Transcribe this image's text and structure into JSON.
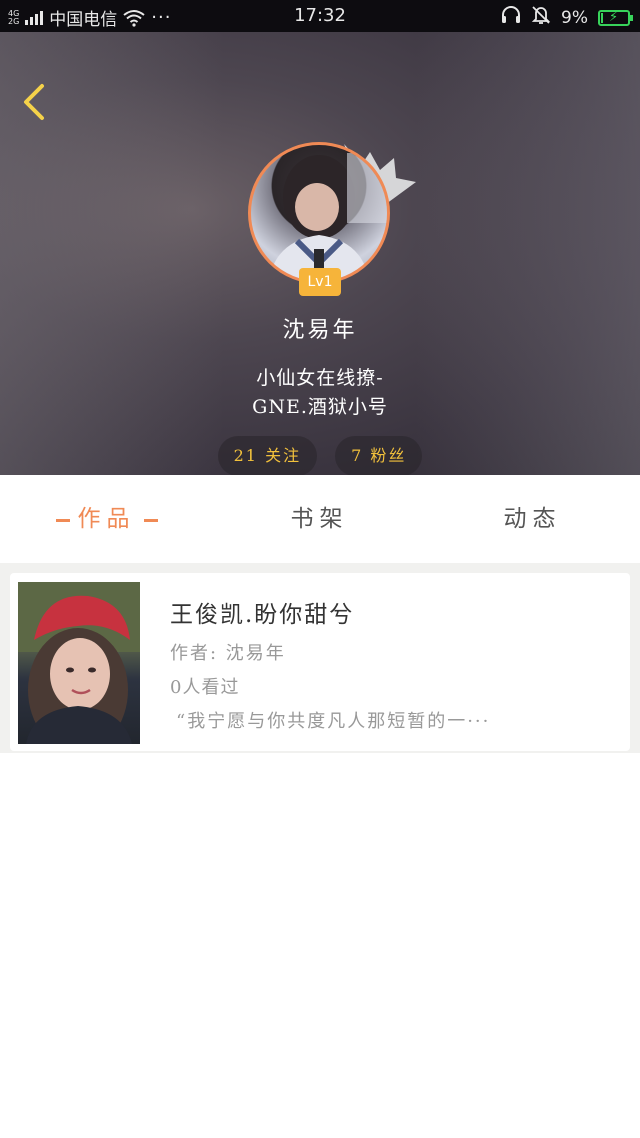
{
  "status_bar": {
    "net_top": "4G",
    "net_bottom": "2G",
    "carrier": "中国电信",
    "more": "···",
    "time": "17:32",
    "battery": "9%"
  },
  "profile": {
    "level": "Lv1",
    "nickname": "沈易年",
    "bio_line1": "小仙女在线撩-",
    "bio_line2": "GNE.酒狱小号",
    "following": "21 关注",
    "followers": "7 粉丝"
  },
  "tabs": [
    {
      "label": "作品",
      "active": true
    },
    {
      "label": "书架",
      "active": false
    },
    {
      "label": "动态",
      "active": false
    }
  ],
  "works": [
    {
      "title": "王俊凯.盼你甜兮",
      "author": "作者: 沈易年",
      "views": "0人看过",
      "excerpt": "“我宁愿与你共度凡人那短暂的一···"
    }
  ],
  "colors": {
    "accent": "#f08a55",
    "level_badge": "#f6b43a",
    "stat_text": "#f2c13c",
    "back_arrow": "#f5d24a"
  },
  "icons": {
    "back": "chevron-left-icon",
    "crown": "crown-icon",
    "headset": "headset-icon",
    "mute_bell": "bell-off-icon",
    "battery": "battery-charging-icon",
    "wifi": "wifi-icon"
  }
}
